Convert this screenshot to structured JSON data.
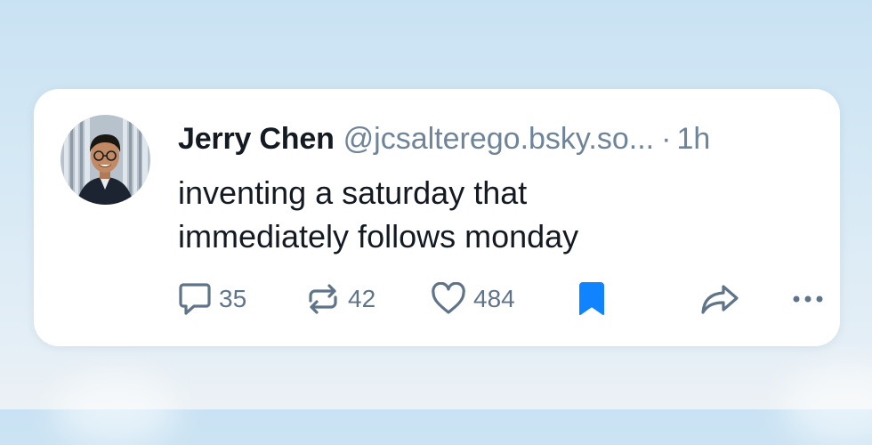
{
  "post": {
    "author": {
      "display_name": "Jerry Chen",
      "handle": "@jcsalterego.bsky.so...",
      "avatar_icon": "user-avatar-photo"
    },
    "separator": "·",
    "time": "1h",
    "text": "inventing a saturday that\nimmediately follows monday",
    "actions": {
      "reply": {
        "icon": "reply-bubble-icon",
        "count": "35"
      },
      "repost": {
        "icon": "repost-arrows-icon",
        "count": "42"
      },
      "like": {
        "icon": "heart-icon",
        "count": "484"
      },
      "bookmark": {
        "icon": "bookmark-icon",
        "saved": true
      },
      "share": {
        "icon": "share-arrow-icon"
      },
      "more": {
        "icon": "more-horizontal-icon"
      }
    }
  },
  "colors": {
    "accent": "#1083fe",
    "muted_text": "#6f8499",
    "primary_text": "#141a22",
    "icon": "#5f7489"
  }
}
